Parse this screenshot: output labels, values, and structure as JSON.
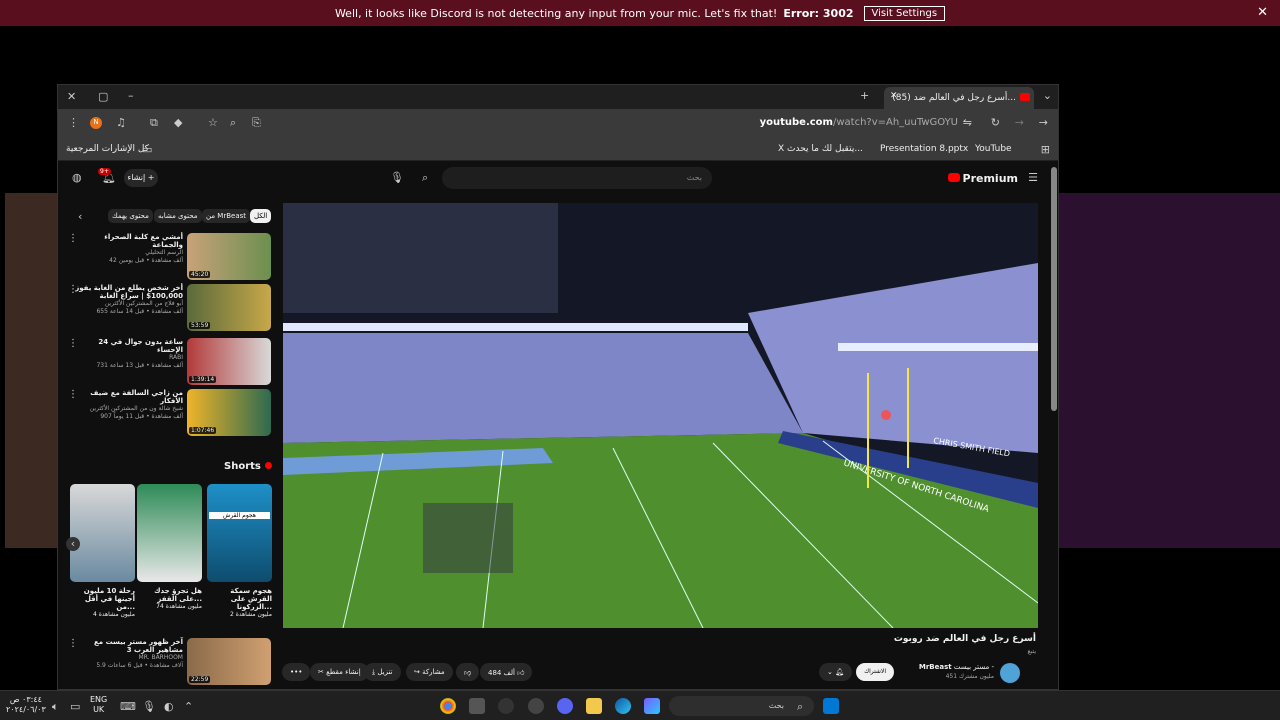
{
  "discord_banner": {
    "message": "Well, it looks like Discord is not detecting any input from your mic. Let's fix that!",
    "error": "Error: 3002",
    "button": "Visit Settings",
    "close": "✕"
  },
  "browser": {
    "tab_title": "(85) أسرع رجل في العالم ضد...",
    "tab_close": "✕",
    "new_tab": "+",
    "profile_initial": "N",
    "url_domain": "youtube.com",
    "url_path": "/watch?v=Ah_uuTwGOYU",
    "bookmarks": [
      {
        "label": "YouTube"
      },
      {
        "label": "Presentation 8.pptx"
      },
      {
        "label": "X يتقبل لك ما يحدث..."
      }
    ],
    "all_bookmarks": "كل الإشارات المرجعية"
  },
  "youtube": {
    "search_placeholder": "بحث",
    "premium": "Premium",
    "create": "إنشاء",
    "notif_count": "9+",
    "chips": [
      "الكل",
      "من MrBeast",
      "محتوى مشابه",
      "محتوى يهمك"
    ],
    "related": [
      {
        "title": "أمشي مع كلبة الصحراء والجماعة",
        "channel": "الرسم التحليلي",
        "stats": "42 ألف مشاهدة • قبل يومين",
        "duration": "45:20",
        "colors": [
          "#c9a27a",
          "#6b8f4e"
        ]
      },
      {
        "title": "أخر شخص يطلع من الغابة يفوز 100,000$ | سراع الغابة",
        "channel": "أبو فلاج من المشتركين الأكثرين",
        "stats": "655 ألف مشاهدة • قبل 14 ساعة",
        "duration": "53:59",
        "colors": [
          "#5a6a3a",
          "#c8a84a"
        ]
      },
      {
        "title": "24 ساعة بدون جوال في الإحساء",
        "channel": "RABI",
        "stats": "731 ألف مشاهدة • قبل 13 ساعة",
        "duration": "1:39:14",
        "colors": [
          "#b33a3a",
          "#d9d9d9"
        ]
      },
      {
        "title": "من زاجي السالفة مع ضيف الأفكار",
        "channel": "شيخ شالة ون من المشتركين الأكثرين",
        "stats": "907 ألف مشاهدة • قبل 11 يوماً",
        "duration": "1:07:46",
        "colors": [
          "#f0b429",
          "#2d6a4f"
        ]
      }
    ],
    "shorts_title": "Shorts",
    "shorts": [
      {
        "title": "رحلة 10 مليون أجينها في أقل من...",
        "views": "4 مليون مشاهدة",
        "overlay": "",
        "colors": [
          "#d8d8d8",
          "#6a8aa0"
        ]
      },
      {
        "title": "هل تجرؤ جدك على القفز...",
        "views": "74 مليون مشاهدة",
        "overlay": "",
        "colors": [
          "#2e8b57",
          "#e8e8e8"
        ]
      },
      {
        "title": "هجوم سمكة القرش على الزركونا...",
        "views": "2 مليون مشاهدة",
        "overlay": "هجوم القرش",
        "colors": [
          "#1e90c8",
          "#0e4c6e"
        ]
      }
    ],
    "bottom_related": {
      "title": "آخر ظهور مستر بيست مع مشاهير العرب 3",
      "channel": "MR. BARHOOM",
      "stats": "5.9 آلاف مشاهدة • قبل 6 ساعات",
      "duration": "22:59"
    },
    "video": {
      "title": "أسرع رجل في العالم ضد روبوت",
      "subtitle": "يتبع",
      "channel": "MrBeast",
      "channel_ar": "مستر بيست -",
      "subscribers": "451 مليون مشترك",
      "subscribe": "الاشتراك",
      "likes": "484 ألف",
      "share": "مشاركة",
      "download": "تنزيل",
      "clip": "إنشاء مقطع",
      "more": "•••",
      "field_text": "CHRIS SMITH FIELD",
      "banner_text": "UNIVERSITY OF NORTH CAROLINA"
    }
  },
  "taskbar": {
    "search": "بحث",
    "lang_top": "ENG",
    "lang_bottom": "UK",
    "time": "٠٣:٤٤ ص",
    "date": "٢٠٢٤/٠٦/٠٣"
  }
}
